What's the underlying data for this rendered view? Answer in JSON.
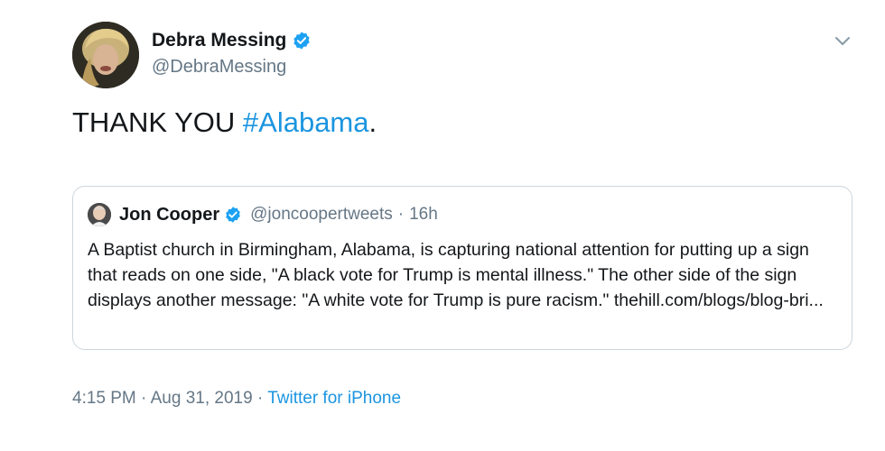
{
  "author": {
    "name": "Debra Messing",
    "handle": "@DebraMessing"
  },
  "tweet": {
    "text": "THANK YOU ",
    "hashtag": "#Alabama",
    "trailing": "."
  },
  "quoted_tweet": {
    "name": "Jon Cooper",
    "handle": "@joncoopertweets",
    "separator": "·",
    "time": "16h",
    "text": "A Baptist church in Birmingham, Alabama, is capturing national attention for putting up a sign that reads on one side, \"A black vote for Trump is mental illness.\" The other side of the sign displays another message: \"A white vote for Trump is pure racism.\" thehill.com/blogs/blog-bri..."
  },
  "footer": {
    "time": "4:15 PM",
    "separator1": "·",
    "date": "Aug 31, 2019",
    "separator2": "·",
    "source": "Twitter for iPhone"
  },
  "colors": {
    "link": "#1b95e0",
    "secondary_text": "#657786",
    "border": "#ccd6dd"
  },
  "icons": {
    "verified": "verified-badge-icon",
    "caret": "chevron-down-icon"
  }
}
